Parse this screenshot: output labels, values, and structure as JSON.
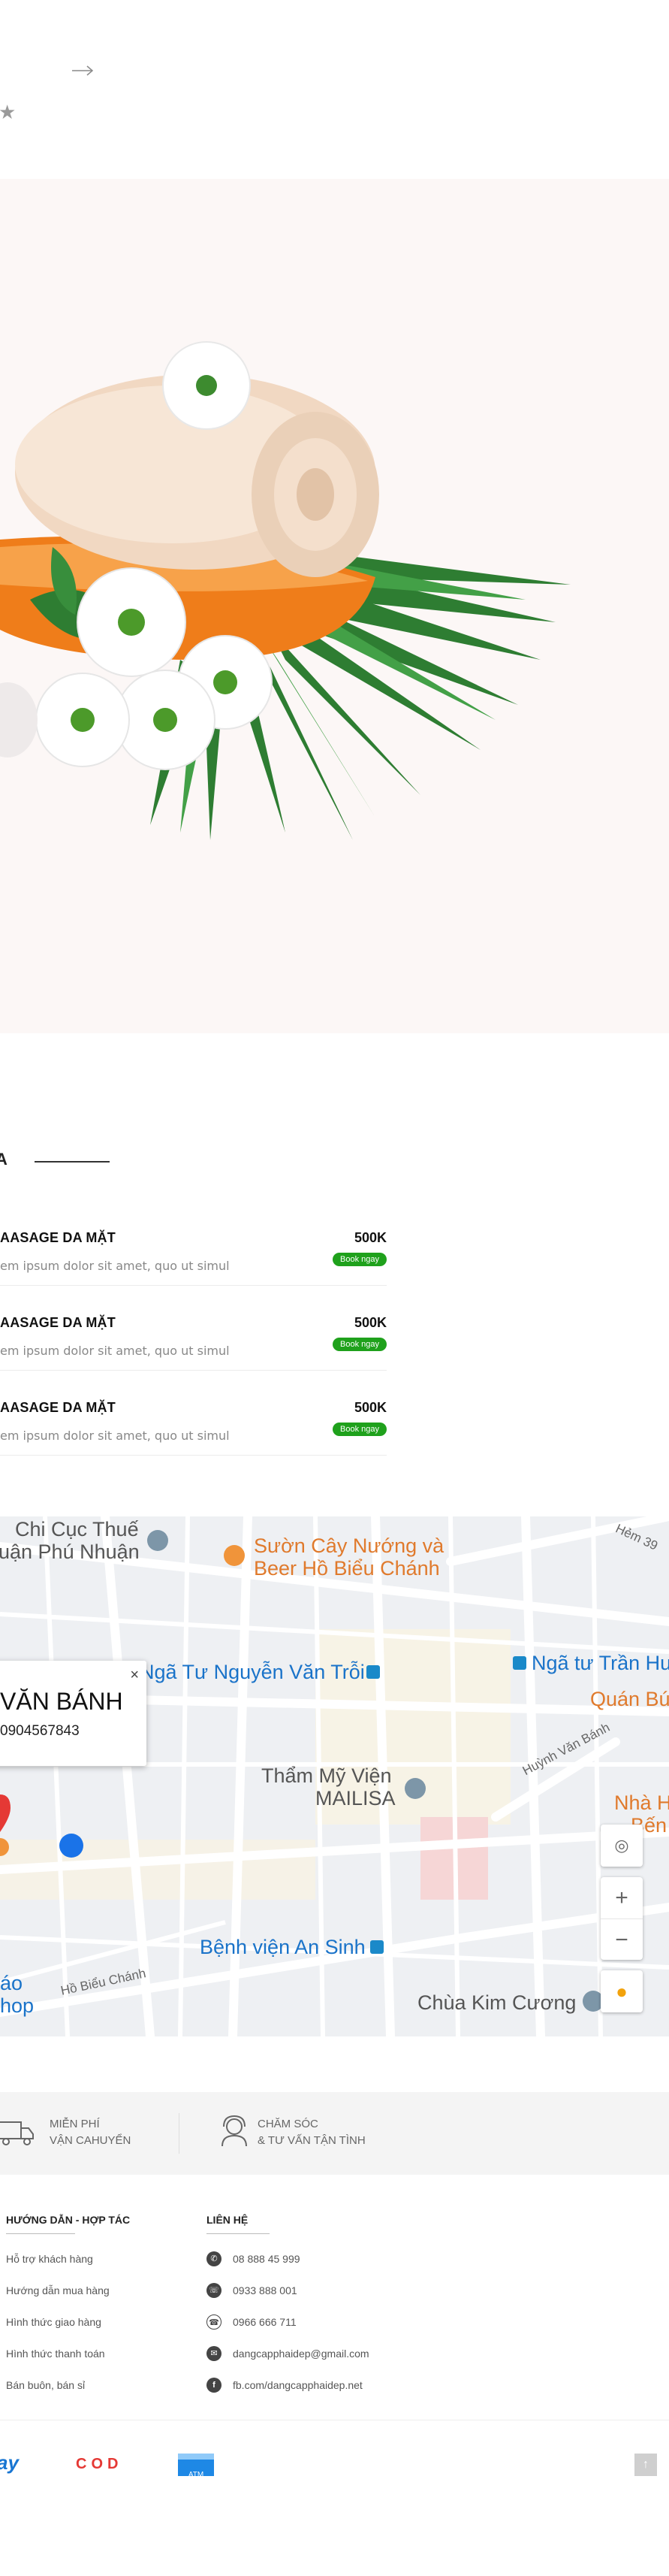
{
  "top": {
    "arrow_icon": "arrow-right-icon",
    "star_icon": "star-icon",
    "star_glyph": "★"
  },
  "hero": {
    "image": "spa-towel-flowers-illustration"
  },
  "services_section": {
    "heading_fragment": "A",
    "items": [
      {
        "name": "AASAGE DA MẶT",
        "description": "em ipsum dolor sit amet, quo ut simul",
        "price": "500K",
        "book_label": "Book ngay"
      },
      {
        "name": "AASAGE DA MẶT",
        "description": "em ipsum dolor sit amet, quo ut simul",
        "price": "500K",
        "book_label": "Book ngay"
      },
      {
        "name": "AASAGE DA MẶT",
        "description": "em ipsum dolor sit amet, quo ut simul",
        "price": "500K",
        "book_label": "Book ngay"
      }
    ]
  },
  "map": {
    "labels": {
      "chi_cuc_1": "Chi Cục Thuế",
      "chi_cuc_2": "uận Phú Nhuận",
      "suon_1": "Sườn Cây Nướng và",
      "suon_2": "Beer Hồ Biểu Chánh",
      "hem": "Hẻm 39",
      "nga_tu_tran": "Ngã tư Trần Hu",
      "nga_tu_nguyen": "Ngã Tư Nguyễn Văn Trỗi",
      "quan_bu": "Quán Bú",
      "tham_my_1": "Thẩm Mỹ Viện",
      "tham_my_2": "MAILISA",
      "huynh_van_bam": "Huỳnh Văn Bánh",
      "nha_h_1": "Nhà H",
      "nha_h_2": "Bến",
      "benh_vien": "Bệnh viện An Sinh",
      "ho_bieu_chanh": "Hồ Biểu Chánh",
      "chua_kim_cuong": "Chùa Kim Cương",
      "ao": "áo",
      "hop": "hop"
    },
    "popup": {
      "title": "VĂN BÁNH",
      "phone": "0904567843",
      "close": "×"
    },
    "controls": {
      "locate_icon": "locate-icon",
      "zoom_in": "+",
      "zoom_out": "−",
      "pegman_icon": "pegman-icon"
    }
  },
  "features": [
    {
      "icon": "truck-icon",
      "line1": "MIỄN PHÍ",
      "line2": "VẬN CAHUYỂN"
    },
    {
      "icon": "support-agent-icon",
      "line1": "CHĂM SÓC",
      "line2": "& TƯ VẤN TẬN TÌNH"
    }
  ],
  "footer": {
    "guide": {
      "heading": "HƯỚNG DẪN - HỢP TÁC",
      "links": [
        "Hỗ trợ khách hàng",
        "Hướng dẫn mua hàng",
        "Hình thức giao hàng",
        "Hình thức thanh toán",
        "Bán buôn, bán sỉ"
      ]
    },
    "contact": {
      "heading": "LIÊN HỆ",
      "items": [
        {
          "icon": "phone-icon",
          "text": "08 888 45 999"
        },
        {
          "icon": "viber-icon",
          "text": "0933 888 001"
        },
        {
          "icon": "telephone-icon",
          "text": "0966 666 711"
        },
        {
          "icon": "email-icon",
          "text": "dangcapphaidep@gmail.com"
        },
        {
          "icon": "facebook-icon",
          "text": "fb.com/dangcapphaidep.net"
        }
      ]
    },
    "payments": {
      "vnpay": "ay",
      "cod": "COD",
      "atm": "ATM"
    },
    "back_to_top": "↑"
  },
  "colors": {
    "book_button": "#1fa11c",
    "hero_bg": "#fcf7f6",
    "map_blue_label": "#1a73c9",
    "map_orange_label": "#e07a2c"
  }
}
